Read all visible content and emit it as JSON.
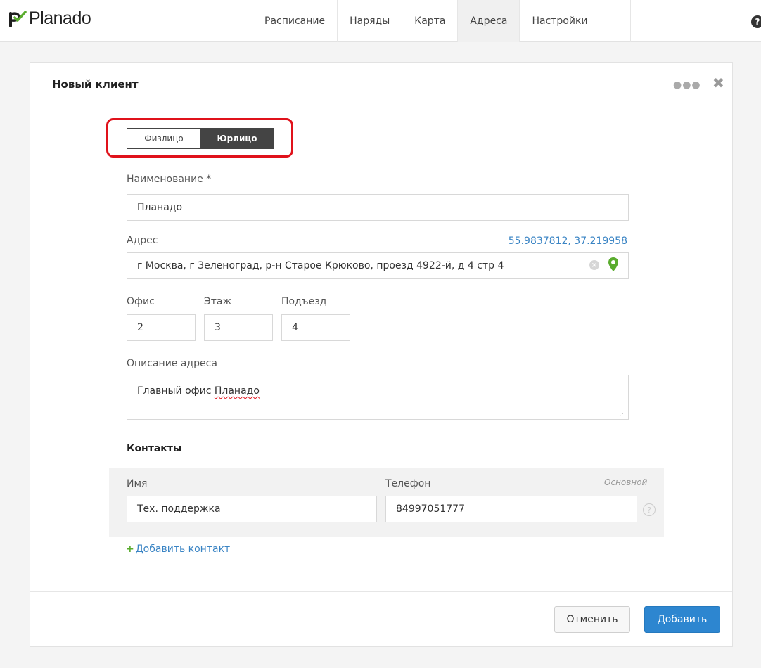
{
  "app": {
    "name": "Planado"
  },
  "nav": [
    {
      "label": "Расписание",
      "active": false
    },
    {
      "label": "Наряды",
      "active": false
    },
    {
      "label": "Карта",
      "active": false
    },
    {
      "label": "Адреса",
      "active": true
    },
    {
      "label": "Настройки",
      "active": false
    }
  ],
  "modal": {
    "title": "Новый клиент",
    "client_type": {
      "options": [
        "Физлицо",
        "Юрлицо"
      ],
      "selected": "Юрлицо"
    },
    "name": {
      "label": "Наименование *",
      "value": "Планадо"
    },
    "address": {
      "label": "Адрес",
      "coords": "55.9837812, 37.219958",
      "value": "г Москва, г Зеленоград, р-н Старое Крюково, проезд 4922-й, д 4 стр 4"
    },
    "office": {
      "label": "Офис",
      "value": "2"
    },
    "floor": {
      "label": "Этаж",
      "value": "3"
    },
    "entrance": {
      "label": "Подъезд",
      "value": "4"
    },
    "address_description": {
      "label": "Описание адреса",
      "text_prefix": "Главный офис ",
      "text_misspelled": "Планадо"
    },
    "contacts": {
      "title": "Контакты",
      "name_label": "Имя",
      "phone_label": "Телефон",
      "main_label": "Основной",
      "items": [
        {
          "name": "Тех. поддержка",
          "phone": "84997051777"
        }
      ],
      "add_label": "Добавить контакт"
    },
    "footer": {
      "cancel_label": "Отменить",
      "submit_label": "Добавить"
    }
  },
  "colors": {
    "accent_blue": "#2d86d0",
    "link_blue": "#3a84c4",
    "brand_green": "#5aac2e",
    "highlight_red": "#e0121b"
  },
  "icons": [
    "planado-logo-icon",
    "help-icon",
    "more-dots-icon",
    "close-icon",
    "clear-icon",
    "map-pin-icon",
    "info-icon",
    "plus-icon"
  ]
}
